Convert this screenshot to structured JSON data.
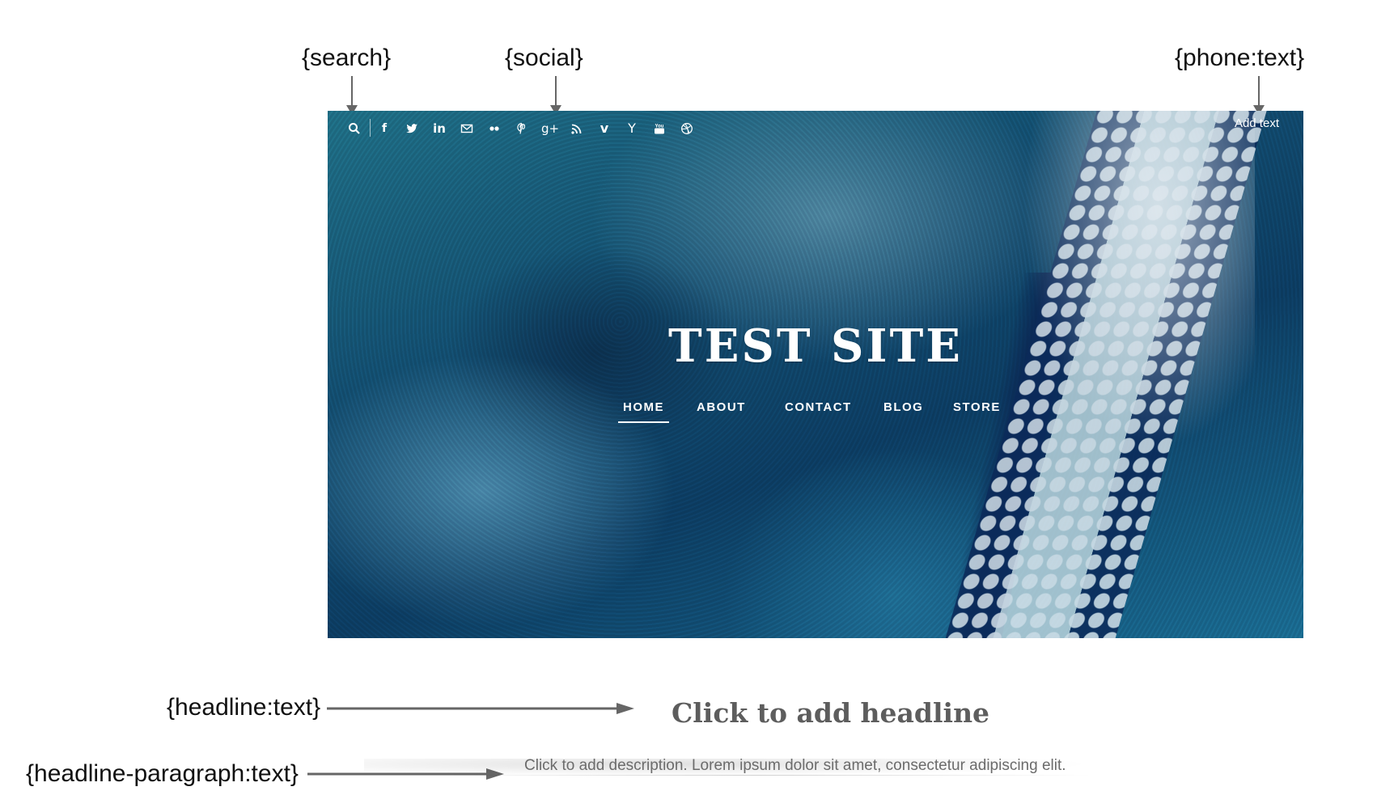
{
  "annotations": {
    "search": "{search}",
    "social": "{social}",
    "phone": "{phone:text}",
    "headline": "{headline:text}",
    "headline_paragraph": "{headline-paragraph:text}"
  },
  "header": {
    "phone_text": "Add text",
    "site_title": "TEST SITE",
    "social_icons": [
      "facebook-icon",
      "twitter-icon",
      "linkedin-icon",
      "email-icon",
      "flickr-icon",
      "pinterest-icon",
      "google-plus-icon",
      "rss-icon",
      "vimeo-icon",
      "yelp-icon",
      "youtube-icon",
      "dribbble-icon"
    ]
  },
  "nav": {
    "items": [
      {
        "label": "HOME",
        "active": true
      },
      {
        "label": "ABOUT"
      },
      {
        "label": "CONTACT"
      },
      {
        "label": "BLOG"
      },
      {
        "label": "STORE"
      }
    ]
  },
  "content": {
    "headline": "Click to add headline",
    "description": "Click to add description. Lorem ipsum dolor sit amet, consectetur adipiscing elit."
  },
  "colors": {
    "annotation_arrow": "#666666",
    "headline": "#5d5d5d",
    "description": "#6b6b6b",
    "hero_text": "#ffffff"
  }
}
